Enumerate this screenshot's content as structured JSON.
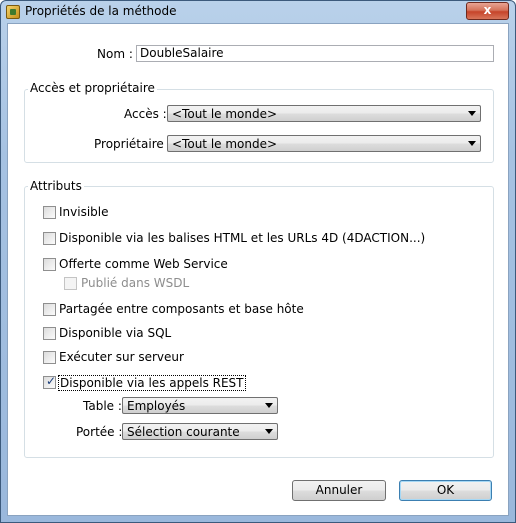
{
  "window": {
    "title": "Propriétés de la méthode",
    "close_label": "x"
  },
  "name": {
    "label": "Nom :",
    "value": "DoubleSalaire"
  },
  "access_group": {
    "title": "Accès et propriétaire",
    "access_label": "Accès :",
    "access_value": "<Tout le monde>",
    "owner_label": "Propriétaire :",
    "owner_value": "<Tout le monde>"
  },
  "attributes_group": {
    "title": "Attributs",
    "options": [
      {
        "label": "Invisible",
        "checked": false
      },
      {
        "label": "Disponible via les balises HTML et les URLs 4D (4DACTION...)",
        "checked": false
      },
      {
        "label": "Offerte comme Web Service",
        "checked": false
      },
      {
        "label": "Publié dans WSDL",
        "checked": false,
        "disabled": true
      },
      {
        "label": "Partagée entre composants et base hôte",
        "checked": false
      },
      {
        "label": "Disponible via SQL",
        "checked": false
      },
      {
        "label": "Exécuter sur serveur",
        "checked": false
      },
      {
        "label": "Disponible via les appels REST",
        "checked": true
      }
    ],
    "table_label": "Table :",
    "table_value": "Employés",
    "scope_label": "Portée :",
    "scope_value": "Sélection courante"
  },
  "buttons": {
    "cancel": "Annuler",
    "ok": "OK"
  }
}
